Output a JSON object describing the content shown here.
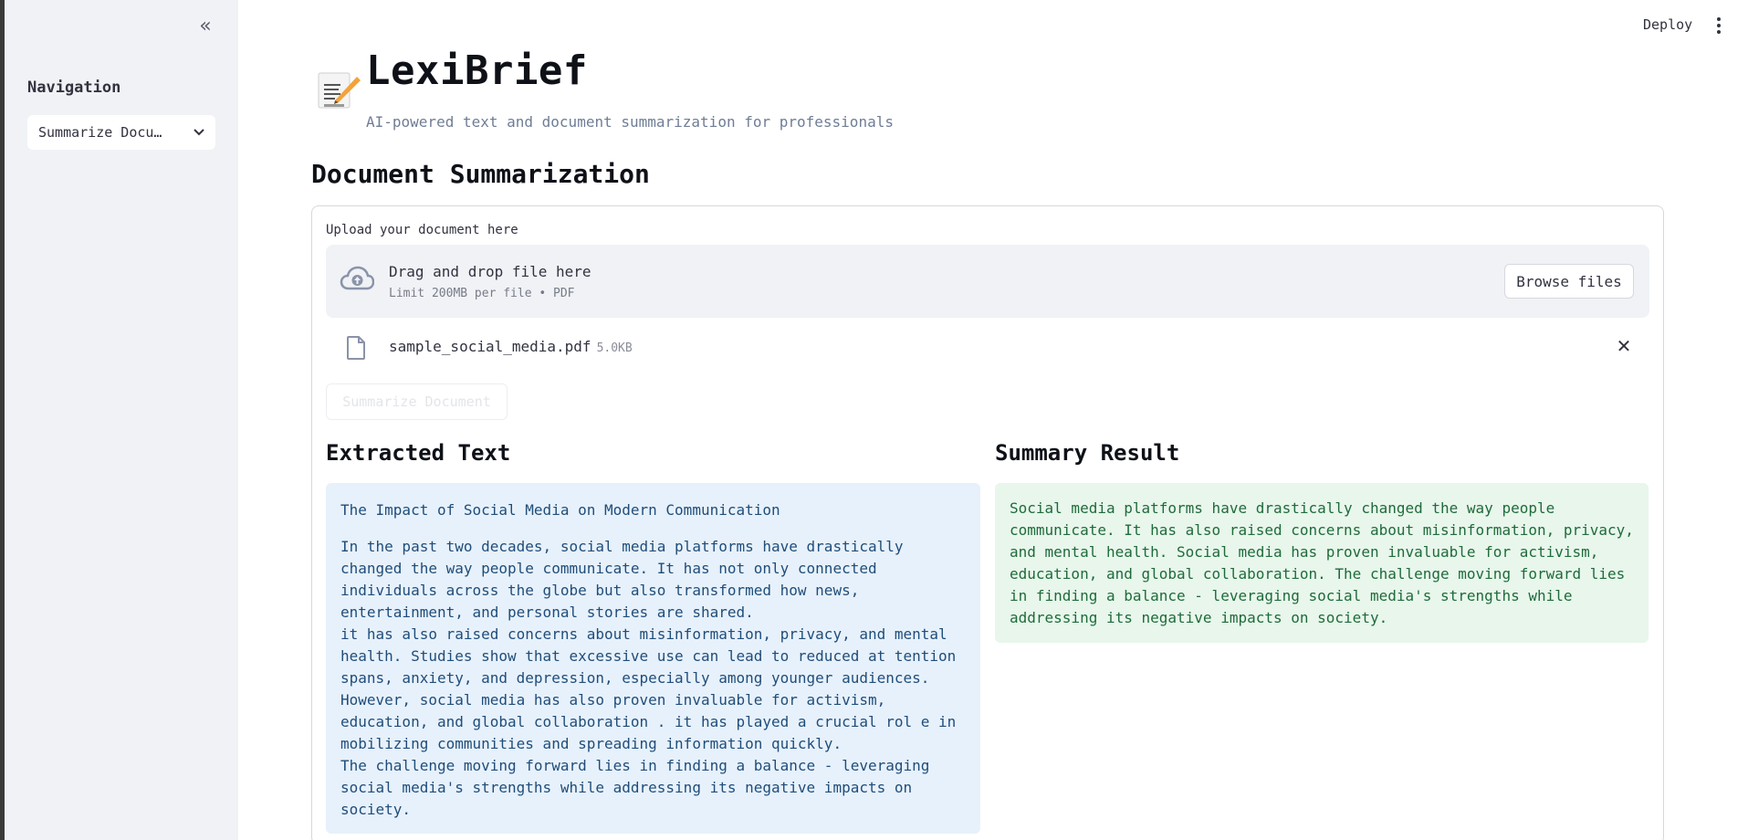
{
  "sidebar": {
    "collapse_icon": "double-chevron-left-icon",
    "nav_label": "Navigation",
    "nav_select_value": "Summarize Docu…"
  },
  "header": {
    "deploy_label": "Deploy",
    "menu_icon": "vertical-dots-icon"
  },
  "app": {
    "icon": "memo-pen-icon",
    "title": "LexiBrief",
    "subtitle": "AI-powered text and document summarization for professionals"
  },
  "main": {
    "section_title": "Document Summarization",
    "uploader": {
      "label": "Upload your document here",
      "drop_title": "Drag and drop file here",
      "limit_text": "Limit 200MB per file • PDF",
      "browse_label": "Browse files",
      "cloud_icon": "cloud-upload-icon"
    },
    "file": {
      "name": "sample_social_media.pdf",
      "size": "5.0KB",
      "icon": "file-icon",
      "remove_icon": "close-icon"
    },
    "summarize_button": "Summarize Document",
    "extracted": {
      "title": "Extracted Text",
      "heading": "The Impact of Social Media on Modern Communication",
      "lines": [
        "In the past two decades, social media platforms have drastically",
        "changed the way people communicate. It has not only connected",
        "individuals across the globe but also transformed how news,",
        "entertainment, and personal stories are shared.",
        "it has also raised concerns about misinformation, privacy, and mental",
        "health. Studies show that excessive use can lead to reduced at tention",
        "spans, anxiety, and depression, especially among younger audiences.",
        "However, social media has also proven invaluable for activism,",
        "education, and global collaboration . it has played a crucial rol e in",
        "mobilizing communities and spreading information quickly.",
        "The challenge moving forward lies in finding a balance - leveraging",
        "social media's strengths while addressing its negative impacts on",
        "society."
      ]
    },
    "summary": {
      "title": "Summary Result",
      "lines": [
        "Social media platforms have drastically changed the way people",
        "communicate. It has also raised concerns about misinformation, privacy,",
        "and mental health. Social media has proven invaluable for activism,",
        "education, and global collaboration. The challenge moving forward lies",
        "in finding a balance - leveraging social media's strengths while",
        "addressing its negative impacts on society."
      ]
    }
  },
  "colors": {
    "sidebar_bg": "#f0f2f6",
    "info_bg": "#e7f1fb",
    "info_text": "#1f4d7a",
    "success_bg": "#e8f6ec",
    "success_text": "#1f6b3a"
  }
}
